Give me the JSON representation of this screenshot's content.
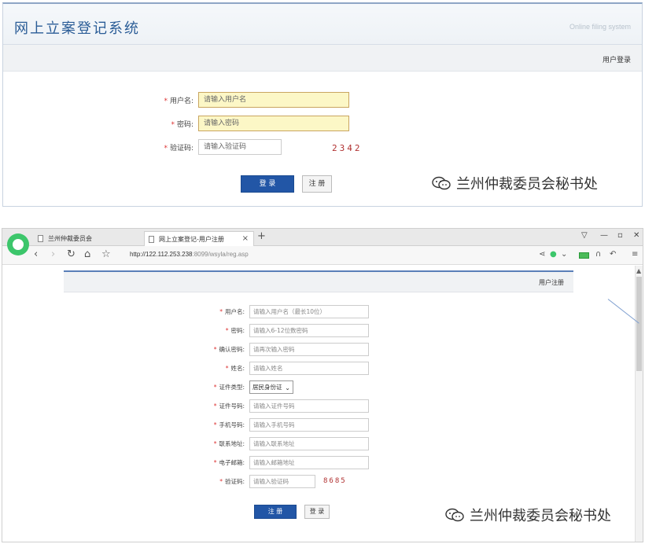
{
  "top": {
    "title": "网上立案登记系统",
    "subtitle": "Online filing system",
    "bar_label": "用户登录",
    "fields": [
      {
        "label": "用户名:",
        "placeholder": "请输入用户名"
      },
      {
        "label": "密码:",
        "placeholder": "请输入密码"
      },
      {
        "label": "验证码:",
        "placeholder": "请输入验证码"
      }
    ],
    "captcha": "2342",
    "login_button": "登 录",
    "register_button": "注 册",
    "watermark": "兰州仲裁委员会秘书处"
  },
  "browser": {
    "tabs": [
      {
        "label": "兰州仲裁委员会"
      },
      {
        "label": "网上立案登记-用户注册"
      }
    ],
    "url_host": "http://122.112.253.238",
    "url_path": ":8099/wsyla/reg.asp",
    "page": {
      "bar_label": "用户注册",
      "fields": [
        {
          "label": "用户名:",
          "placeholder": "请输入用户名（最长10位）"
        },
        {
          "label": "密码:",
          "placeholder": "请输入6-12位数密码"
        },
        {
          "label": "确认密码:",
          "placeholder": "请再次输入密码"
        },
        {
          "label": "姓名:",
          "placeholder": "请输入姓名"
        },
        {
          "label": "证件类型:",
          "selected": "居民身份证"
        },
        {
          "label": "证件号码:",
          "placeholder": "请输入证件号码"
        },
        {
          "label": "手机号码:",
          "placeholder": "请输入手机号码"
        },
        {
          "label": "联系地址:",
          "placeholder": "请输入联系地址"
        },
        {
          "label": "电子邮箱:",
          "placeholder": "请输入邮箱地址"
        },
        {
          "label": "验证码:",
          "placeholder": "请输入验证码"
        }
      ],
      "captcha": "8685",
      "register_button": "注 册",
      "login_button": "登 录"
    },
    "watermark": "兰州仲裁委员会秘书处"
  }
}
